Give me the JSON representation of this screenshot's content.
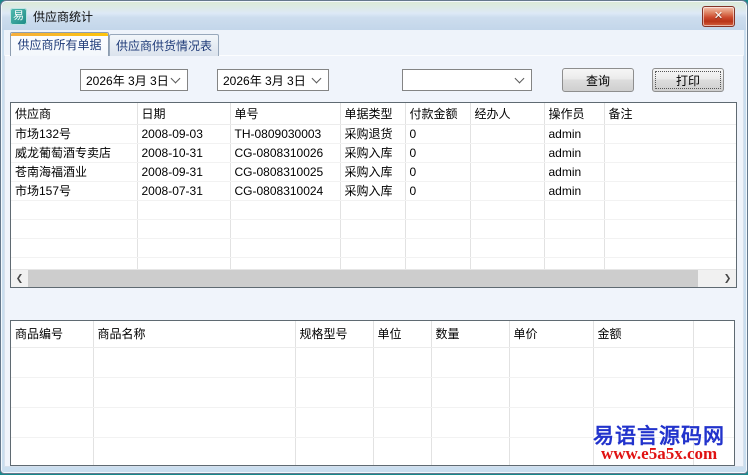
{
  "window": {
    "title": "供应商统计",
    "app_icon_glyph": "易"
  },
  "tabs": [
    {
      "label": "供应商所有单据"
    },
    {
      "label": "供应商供货情况表"
    }
  ],
  "toolbar": {
    "date_from": "2026年 3月 3日",
    "date_to": "2026年 3月 3日",
    "filter_value": "",
    "query_label": "查询",
    "print_label": "打印"
  },
  "bills_table": {
    "columns": [
      "供应商",
      "日期",
      "单号",
      "单据类型",
      "付款金额",
      "经办人",
      "操作员",
      "备注"
    ],
    "rows": [
      [
        "市场132号",
        "2008-09-03",
        "TH-0809030003",
        "采购退货",
        "0",
        "",
        "admin",
        ""
      ],
      [
        "威龙葡萄酒专卖店",
        "2008-10-31",
        "CG-0808310026",
        "采购入库",
        "0",
        "",
        "admin",
        ""
      ],
      [
        "苍南海福酒业",
        "2008-09-31",
        "CG-0808310025",
        "采购入库",
        "0",
        "",
        "admin",
        ""
      ],
      [
        "市场157号",
        "2008-07-31",
        "CG-0808310024",
        "采购入库",
        "0",
        "",
        "admin",
        ""
      ]
    ]
  },
  "goods_table": {
    "columns": [
      "商品编号",
      "商品名称",
      "规格型号",
      "单位",
      "数量",
      "单价",
      "金额"
    ],
    "rows": []
  },
  "watermark": {
    "site_name": "易语言源码网",
    "site_url": "www.e5a5x.com"
  },
  "colors": {
    "tab_accent_orange": "#f8b430",
    "close_button_red": "#cc4a2e",
    "site_name_blue": "#2233cc",
    "site_url_red": "#e01212",
    "desktop_teal": "#17898b"
  }
}
